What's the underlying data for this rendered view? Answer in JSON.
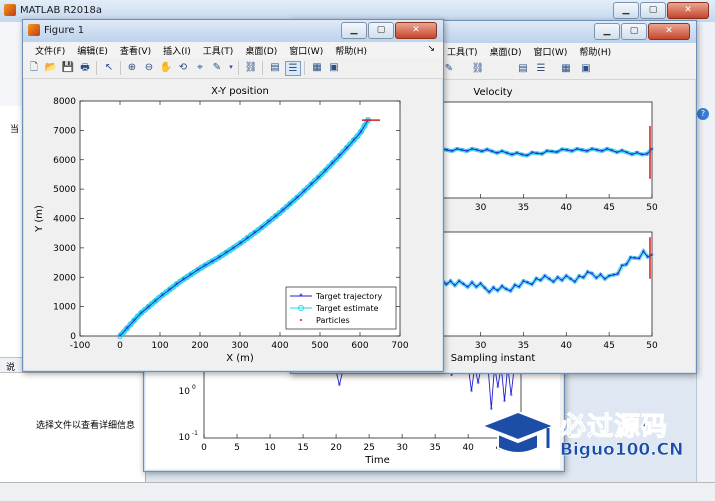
{
  "desktop": {
    "title": "MATLAB R2018a"
  },
  "matlab_side": {
    "current_folder_prefix": "当",
    "file_details_hint": "选择文件以查看详细信息",
    "status_left": "说"
  },
  "figure1": {
    "title": "Figure 1",
    "menu": [
      "文件(F)",
      "编辑(E)",
      "查看(V)",
      "插入(I)",
      "工具(T)",
      "桌面(D)",
      "窗口(W)",
      "帮助(H)"
    ]
  },
  "figure2": {
    "menu_visible": [
      "工具(T)",
      "桌面(D)",
      "窗口(W)",
      "帮助(H)"
    ]
  },
  "watermark": {
    "cn_text": "必过源码",
    "en_text": "Biguo100.CN"
  },
  "icons": [
    "new-figure-icon",
    "open-icon",
    "save-icon",
    "print-icon",
    "pointer-icon",
    "zoom-in-icon",
    "zoom-out-icon",
    "pan-icon",
    "rotate-icon",
    "data-cursor-icon",
    "brush-icon",
    "link-icon",
    "colorbar-icon",
    "legend-icon",
    "hide-plot-tools-icon",
    "show-plot-tools-icon"
  ],
  "chart_data": [
    {
      "type": "line",
      "title": "X-Y position",
      "xlabel": "X (m)",
      "ylabel": "Y (m)",
      "xlim": [
        -100,
        700
      ],
      "ylim": [
        0,
        8000
      ],
      "xticks": [
        -100,
        0,
        100,
        200,
        300,
        400,
        500,
        600,
        700
      ],
      "yticks": [
        0,
        1000,
        2000,
        3000,
        4000,
        5000,
        6000,
        7000,
        8000
      ],
      "legend_position": "bottom-right",
      "series": [
        {
          "name": "Target trajectory",
          "color": "#1f1fd6",
          "marker": "*",
          "x": [
            0,
            50,
            100,
            150,
            200,
            250,
            300,
            350,
            400,
            450,
            500,
            550,
            600,
            620
          ],
          "y": [
            0,
            750,
            1330,
            1850,
            2300,
            2700,
            3150,
            3650,
            4200,
            4800,
            5450,
            6150,
            6900,
            7350
          ]
        },
        {
          "name": "Target estimate",
          "color": "#22d4e8",
          "marker": "o",
          "x": [
            0,
            50,
            100,
            150,
            200,
            250,
            300,
            350,
            400,
            450,
            500,
            550,
            600,
            620
          ],
          "y": [
            0,
            750,
            1330,
            1850,
            2300,
            2700,
            3150,
            3650,
            4200,
            4800,
            5450,
            6150,
            6900,
            7350
          ]
        },
        {
          "name": "Particles",
          "color": "#d12020",
          "marker": "."
        }
      ]
    },
    {
      "type": "line",
      "title": "Velocity",
      "xticks": [
        20,
        25,
        30,
        35,
        40,
        45,
        50
      ],
      "xlim": [
        15,
        50
      ],
      "series": [
        {
          "color": "#1f1fd6",
          "marker": "*",
          "x": [
            15,
            20,
            25,
            30,
            35,
            40,
            45,
            49,
            50
          ],
          "y": [
            52,
            51,
            50,
            50,
            49,
            50,
            50,
            49,
            50
          ]
        }
      ]
    },
    {
      "type": "line",
      "xlabel": "Sampling instant",
      "xticks": [
        20,
        25,
        30,
        35,
        40,
        45,
        50
      ],
      "xlim": [
        15,
        50
      ],
      "series": [
        {
          "color": "#1f1fd6",
          "marker": "*",
          "x": [
            15,
            17,
            19,
            21,
            23,
            25,
            27,
            29,
            31,
            33,
            35,
            37,
            39,
            41,
            43,
            45,
            47,
            49,
            50
          ],
          "y": [
            0.55,
            0.5,
            0.35,
            0.3,
            0.45,
            0.55,
            0.5,
            0.5,
            0.45,
            0.45,
            0.5,
            0.55,
            0.55,
            0.55,
            0.6,
            0.55,
            0.7,
            0.8,
            0.75
          ]
        }
      ]
    },
    {
      "type": "line",
      "xlabel": "Time",
      "yscale": "log",
      "ylim": [
        0.1,
        1
      ],
      "xticks": [
        0,
        5,
        10,
        15,
        20,
        25,
        30,
        35,
        40,
        45
      ],
      "ytick_labels": [
        "10^-1",
        "10^0"
      ],
      "xlim": [
        0,
        48
      ],
      "series": [
        {
          "color": "#1f1fd6",
          "marker": "*"
        }
      ]
    }
  ]
}
